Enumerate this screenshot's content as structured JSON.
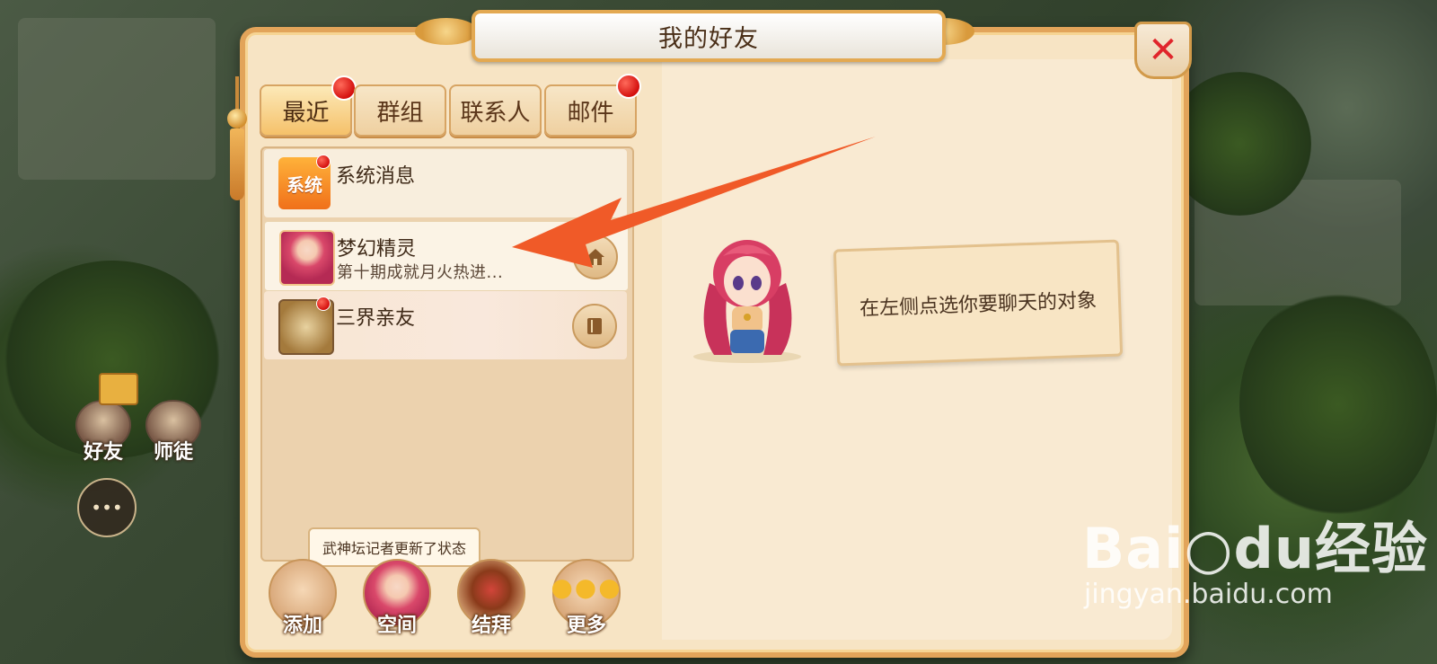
{
  "dialog": {
    "title": "我的好友",
    "close_glyph": "✕"
  },
  "tabs": [
    {
      "label": "最近",
      "active": true,
      "has_dot": true
    },
    {
      "label": "群组",
      "active": false,
      "has_dot": false
    },
    {
      "label": "联系人",
      "active": false,
      "has_dot": false
    },
    {
      "label": "邮件",
      "active": false,
      "has_dot": true
    }
  ],
  "conversations": [
    {
      "name": "系统消息",
      "preview": "",
      "avatar_text": "系统",
      "has_dot": true,
      "action_icon": ""
    },
    {
      "name": "梦幻精灵",
      "preview": "第十期成就月火热进...",
      "avatar_text": "",
      "has_dot": false,
      "action_icon": "home-icon"
    },
    {
      "name": "三界亲友",
      "preview": "",
      "avatar_text": "",
      "has_dot": true,
      "action_icon": "book-icon"
    }
  ],
  "tooltip": "武神坛记者更新了状态",
  "toolbar": {
    "add_label": "添加",
    "space_label": "空间",
    "sworn_label": "结拜",
    "more_label": "更多"
  },
  "empty_state": {
    "hint": "在左侧点选你要聊天的对象"
  },
  "hud": {
    "friends_label": "好友",
    "mentor_label": "师徒"
  },
  "watermark": {
    "logo": "Bai○du经验",
    "url": "jingyan.baidu.com"
  },
  "colors": {
    "panel_border": "#e2a45a",
    "red_dot": "#d4100e",
    "close_x": "#e0252b",
    "arrow": "#f05a28"
  }
}
